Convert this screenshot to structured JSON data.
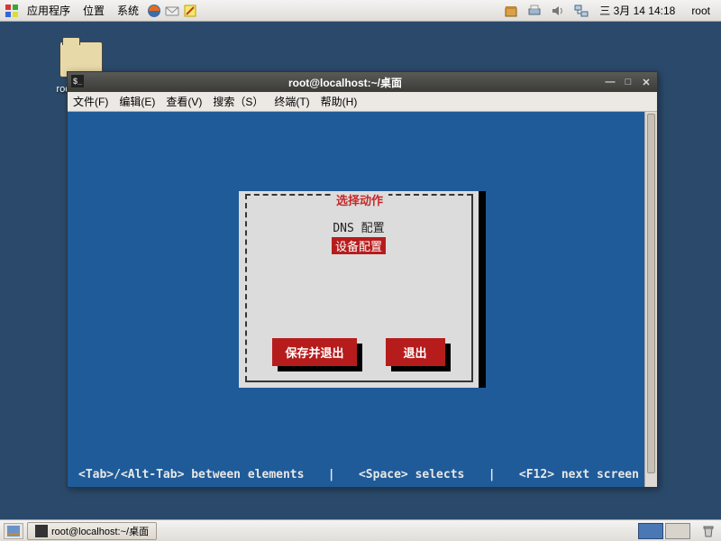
{
  "top_panel": {
    "menus": [
      "应用程序",
      "位置",
      "系统"
    ],
    "clock": "三 3月 14 14:18",
    "user": "root"
  },
  "desktop_icon": {
    "label": "root 的主文件夹"
  },
  "window": {
    "title": "root@localhost:~/桌面",
    "menubar": [
      "文件(F)",
      "编辑(E)",
      "查看(V)",
      "搜索（S）",
      "终端(T)",
      "帮助(H)"
    ]
  },
  "tui": {
    "dialog_title": "选择动作",
    "option1": "DNS 配置",
    "option2_selected": "设备配置",
    "button_save": "保存并退出",
    "button_quit": "退出",
    "footer_left": "<Tab>/<Alt-Tab> between elements",
    "footer_sep1": "|",
    "footer_mid": "<Space> selects",
    "footer_sep2": "|",
    "footer_right": "<F12> next screen"
  },
  "taskbar": {
    "task_label": "root@localhost:~/桌面"
  }
}
